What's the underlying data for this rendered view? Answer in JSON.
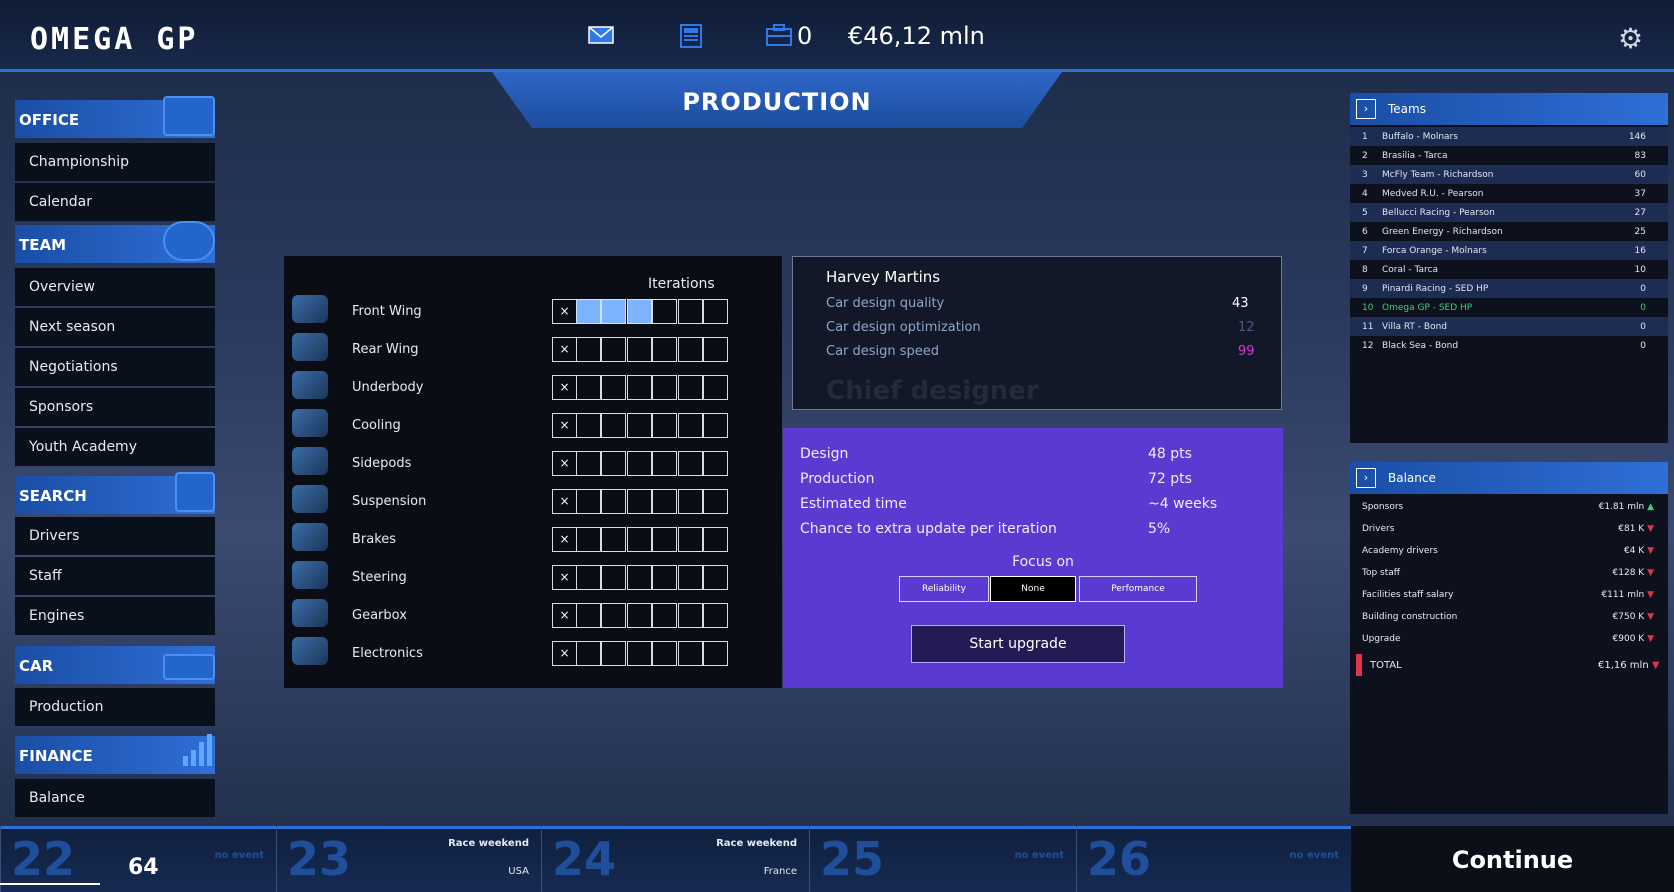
{
  "header": {
    "logo": "OMEGA GP",
    "money_count": "0",
    "money": "€46,12 mln",
    "icons": [
      "mail-icon",
      "news-icon",
      "briefcase-icon",
      "gear-icon"
    ]
  },
  "page": {
    "title": "PRODUCTION"
  },
  "sidebar": {
    "office": {
      "title": "OFFICE",
      "items": [
        "Championship",
        "Calendar"
      ]
    },
    "team": {
      "title": "TEAM",
      "items": [
        "Overview",
        "Next season",
        "Negotiations",
        "Sponsors",
        "Youth Academy"
      ]
    },
    "search": {
      "title": "SEARCH",
      "items": [
        "Drivers",
        "Staff",
        "Engines"
      ]
    },
    "car": {
      "title": "CAR",
      "items": [
        "Production"
      ]
    },
    "finance": {
      "title": "FINANCE",
      "items": [
        "Balance"
      ]
    }
  },
  "production": {
    "header": "Iterations",
    "parts": [
      {
        "name": "Front Wing",
        "iterations": 3
      },
      {
        "name": "Rear Wing",
        "iterations": 0
      },
      {
        "name": "Underbody",
        "iterations": 0
      },
      {
        "name": "Cooling",
        "iterations": 0
      },
      {
        "name": "Sidepods",
        "iterations": 0
      },
      {
        "name": "Suspension",
        "iterations": 0
      },
      {
        "name": "Brakes",
        "iterations": 0
      },
      {
        "name": "Steering",
        "iterations": 0
      },
      {
        "name": "Gearbox",
        "iterations": 0
      },
      {
        "name": "Electronics",
        "iterations": 0
      }
    ],
    "remove_symbol": "×"
  },
  "designer": {
    "name": "Harvey Martins",
    "role": "Chief designer",
    "stats": [
      {
        "label": "Car design quality",
        "value": "43"
      },
      {
        "label": "Car design optimization",
        "value": "12"
      },
      {
        "label": "Car design speed",
        "value": "99"
      }
    ]
  },
  "upgrade": {
    "rows": [
      {
        "label": "Design",
        "value": "48 pts"
      },
      {
        "label": "Production",
        "value": "72 pts"
      },
      {
        "label": "Estimated time",
        "value": "~4 weeks"
      },
      {
        "label": "Chance to extra update per iteration",
        "value": "5%"
      }
    ],
    "focus_label": "Focus on",
    "focus_options": [
      "Reliability",
      "None",
      "Perfomance"
    ],
    "focus_selected": "None",
    "start_label": "Start upgrade"
  },
  "teams": {
    "title": "Teams",
    "rows": [
      {
        "n": "1",
        "team": "Buffalo - Molnars",
        "pts": "146"
      },
      {
        "n": "2",
        "team": "Brasilia - Tarca",
        "pts": "83"
      },
      {
        "n": "3",
        "team": "McFly Team - Richardson",
        "pts": "60"
      },
      {
        "n": "4",
        "team": "Medved R.U. - Pearson",
        "pts": "37"
      },
      {
        "n": "5",
        "team": "Bellucci Racing - Pearson",
        "pts": "27"
      },
      {
        "n": "6",
        "team": "Green Energy - Richardson",
        "pts": "25"
      },
      {
        "n": "7",
        "team": "Forca Orange - Molnars",
        "pts": "16"
      },
      {
        "n": "8",
        "team": "Coral - Tarca",
        "pts": "10"
      },
      {
        "n": "9",
        "team": "Pinardi Racing - SED HP",
        "pts": "0"
      },
      {
        "n": "10",
        "team": "Omega GP - SED HP",
        "pts": "0"
      },
      {
        "n": "11",
        "team": "Villa RT - Bond",
        "pts": "0"
      },
      {
        "n": "12",
        "team": "Black Sea - Bond",
        "pts": "0"
      }
    ],
    "highlight_team": "Omega GP - SED HP"
  },
  "balance": {
    "title": "Balance",
    "rows": [
      {
        "label": "Sponsors",
        "value": "€1.81 mln",
        "trend": "up"
      },
      {
        "label": "Drivers",
        "value": "€81 K",
        "trend": "down"
      },
      {
        "label": "Academy drivers",
        "value": "€4 K",
        "trend": "down"
      },
      {
        "label": "Top staff",
        "value": "€128 K",
        "trend": "down"
      },
      {
        "label": "Facilities staff salary",
        "value": "€111 mln",
        "trend": "down"
      },
      {
        "label": "Building construction",
        "value": "€750 K",
        "trend": "down"
      },
      {
        "label": "Upgrade",
        "value": "€900 K",
        "trend": "down"
      }
    ],
    "total_label": "TOTAL",
    "total_value": "€1,16 mln",
    "total_trend": "down"
  },
  "calendar": {
    "days": [
      {
        "day": "22",
        "event": "no event",
        "location": ""
      },
      {
        "day": "23",
        "event": "Race weekend",
        "location": "USA"
      },
      {
        "day": "24",
        "event": "Race weekend",
        "location": "France"
      },
      {
        "day": "25",
        "event": "no event",
        "location": ""
      },
      {
        "day": "26",
        "event": "no event",
        "location": ""
      }
    ],
    "continue_label": "Continue"
  },
  "page_number": "64",
  "colors": {
    "accent": "#2f6fd6",
    "purple_panel": "#5a3ad0",
    "iteration_on": "#7cb4ff",
    "trend_up": "#3ecf7a",
    "trend_down": "#e0344c",
    "highlight_team": "#3ecf7a",
    "speed_value": "#d040d0"
  }
}
